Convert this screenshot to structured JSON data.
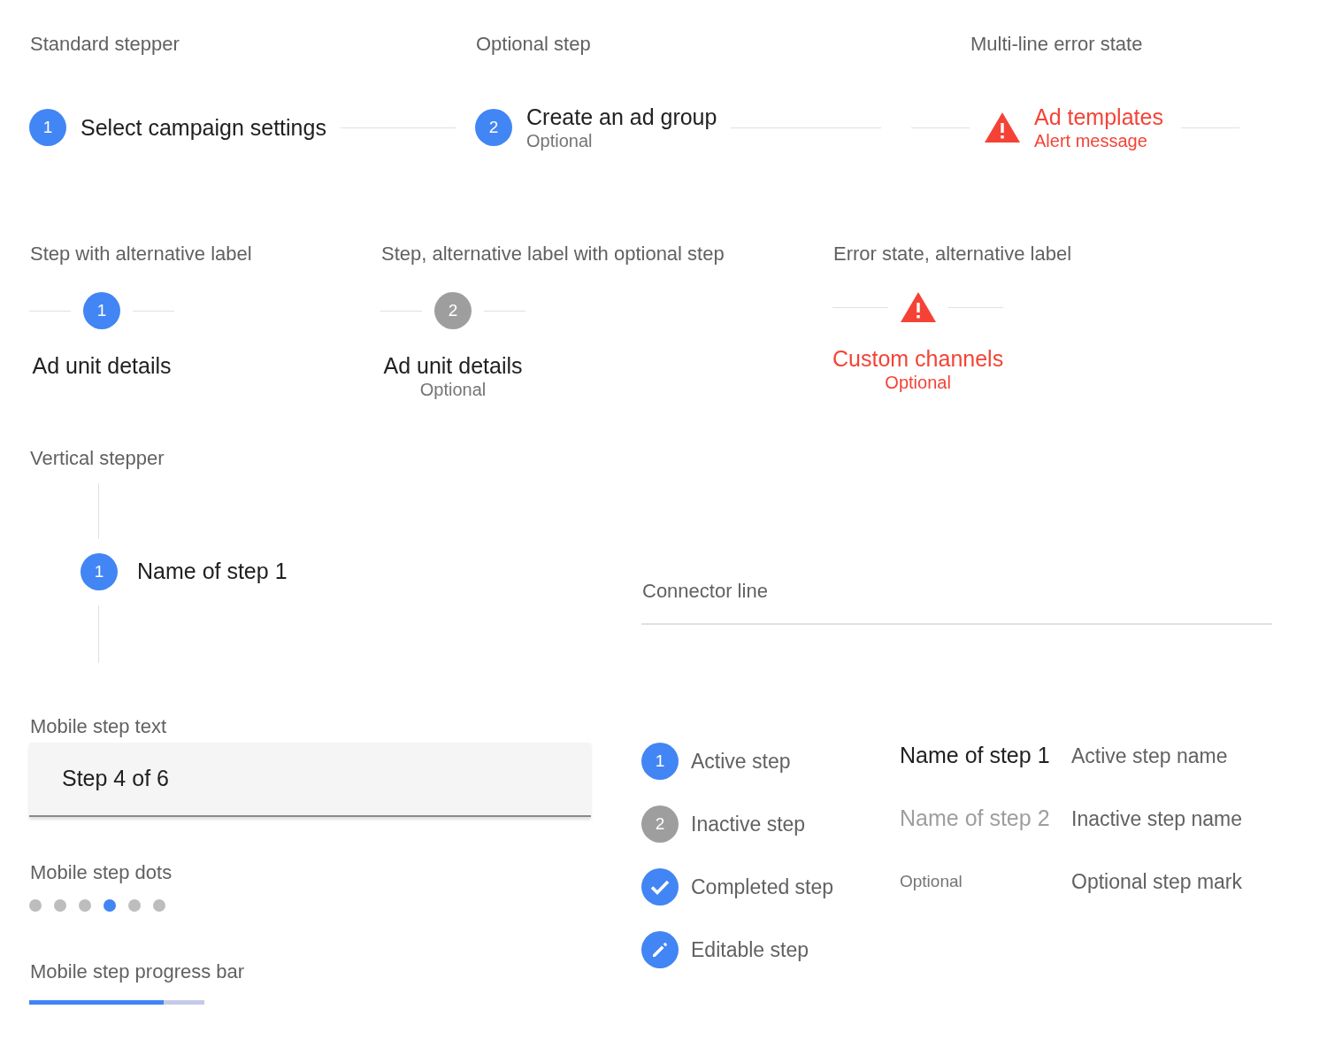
{
  "horizontal": [
    {
      "heading": "Standard stepper",
      "step": {
        "kind": "active",
        "number": "1",
        "label": "Select campaign settings"
      }
    },
    {
      "heading": "Optional step",
      "step": {
        "kind": "active",
        "number": "2",
        "label": "Create an ad group",
        "sublabel": "Optional"
      }
    },
    {
      "heading": "Multi-line error state",
      "step": {
        "kind": "error",
        "label": "Ad templates",
        "sublabel": "Alert message"
      }
    }
  ],
  "alternative": [
    {
      "heading": "Step with alternative label",
      "step": {
        "kind": "active",
        "number": "1",
        "label": "Ad unit details"
      }
    },
    {
      "heading": "Step, alternative label with optional step",
      "step": {
        "kind": "inactive",
        "number": "2",
        "label": "Ad unit details",
        "sublabel": "Optional"
      }
    },
    {
      "heading": "Error state, alternative label",
      "step": {
        "kind": "error",
        "label": "Custom channels",
        "sublabel": "Optional"
      }
    }
  ],
  "vertical": {
    "heading": "Vertical stepper",
    "step": {
      "kind": "active",
      "number": "1",
      "label": "Name of step 1"
    }
  },
  "connector": {
    "heading": "Connector line"
  },
  "mobile_text": {
    "heading": "Mobile step text",
    "text": "Step 4 of 6"
  },
  "mobile_dots": {
    "heading": "Mobile step dots",
    "dots": [
      {
        "selected": false
      },
      {
        "selected": false
      },
      {
        "selected": false
      },
      {
        "selected": true
      },
      {
        "selected": false
      },
      {
        "selected": false
      }
    ]
  },
  "mobile_progress": {
    "heading": "Mobile step progress bar",
    "level": 0.77
  },
  "legend_icons": [
    {
      "kind": "active",
      "number": "1",
      "label": "Active step"
    },
    {
      "kind": "inactive",
      "number": "2",
      "label": "Inactive step"
    },
    {
      "kind": "completed",
      "label": "Completed step"
    },
    {
      "kind": "editable",
      "label": "Editable step"
    }
  ],
  "legend_names": [
    {
      "kind": "active",
      "sample": "Name of step 1",
      "label": "Active step name"
    },
    {
      "kind": "inactive",
      "sample": "Name of step 2",
      "label": "Inactive step name"
    },
    {
      "kind": "optional",
      "sample": "Optional",
      "label": "Optional step mark"
    }
  ]
}
